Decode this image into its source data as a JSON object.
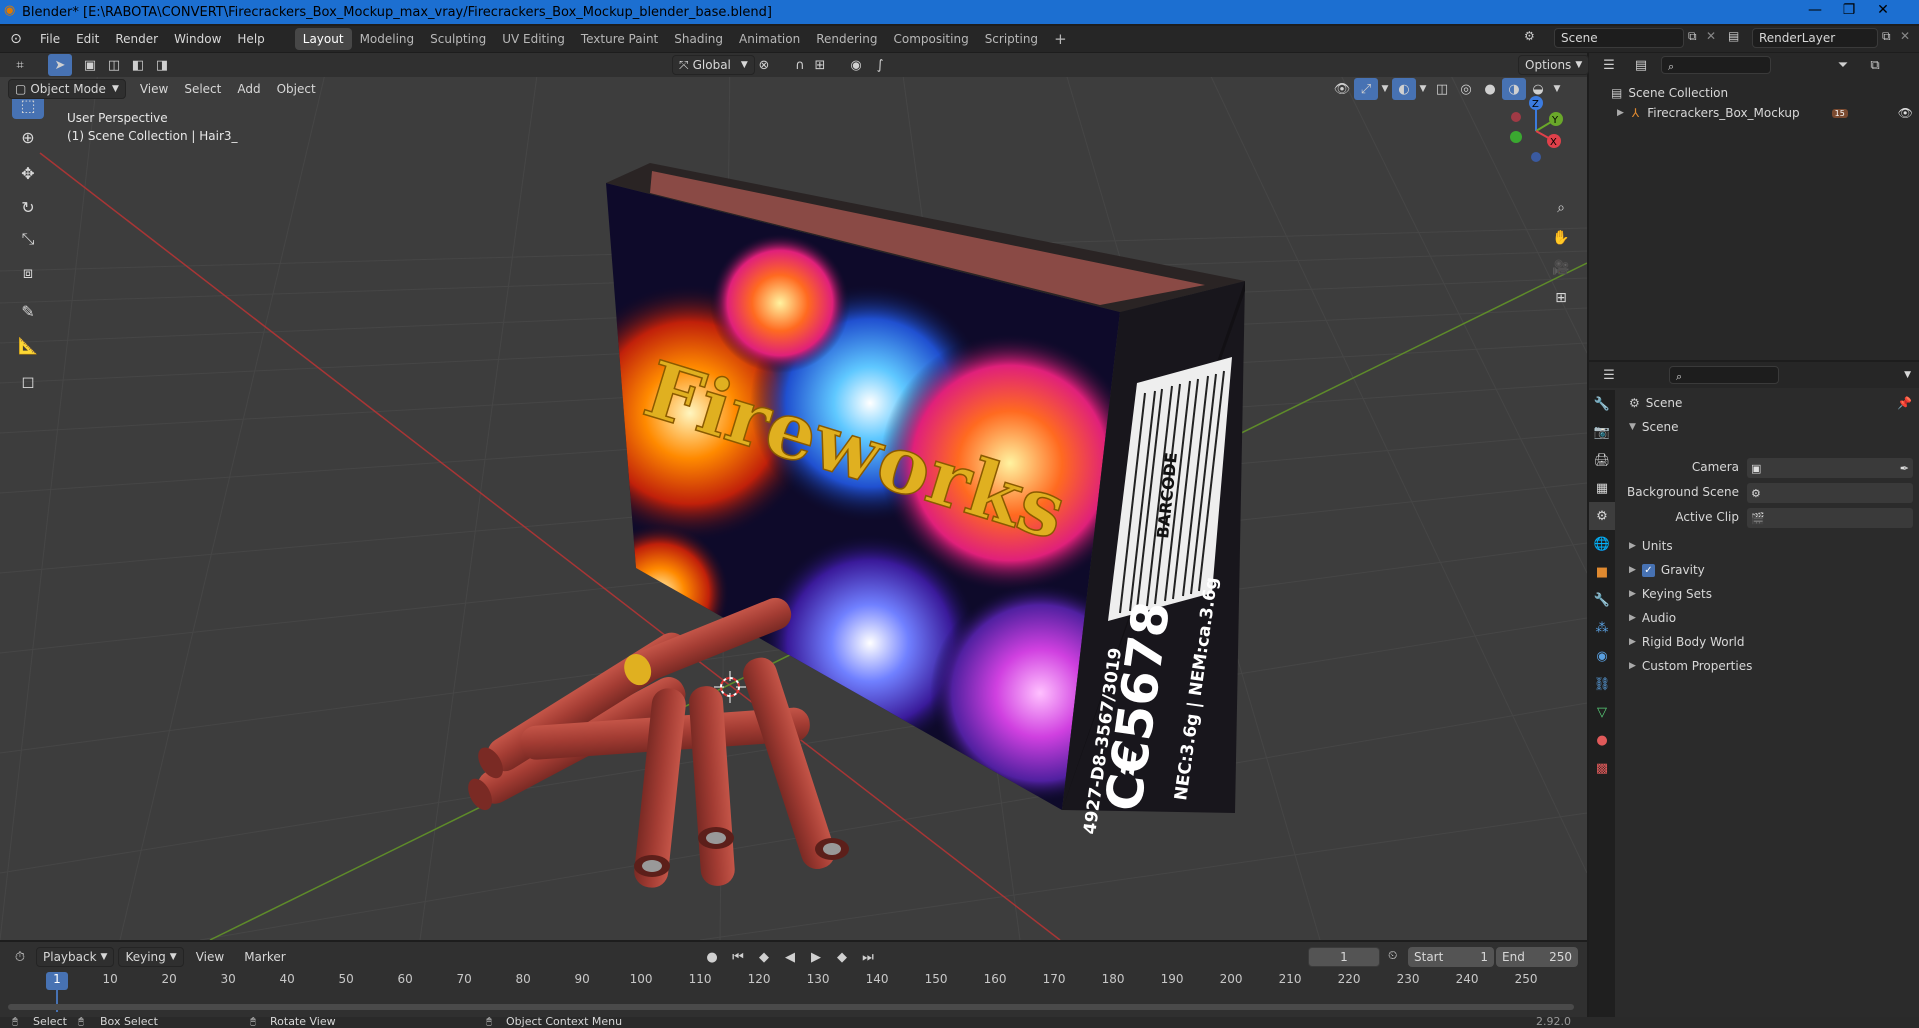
{
  "window": {
    "title": "Blender* [E:\\RABOTA\\CONVERT\\Firecrackers_Box_Mockup_max_vray/Firecrackers_Box_Mockup_blender_base.blend]",
    "controls": [
      "—",
      "❐",
      "✕"
    ]
  },
  "menu": [
    "File",
    "Edit",
    "Render",
    "Window",
    "Help"
  ],
  "workspaces": [
    "Layout",
    "Modeling",
    "Sculpting",
    "UV Editing",
    "Texture Paint",
    "Shading",
    "Animation",
    "Rendering",
    "Compositing",
    "Scripting"
  ],
  "active_workspace": "Layout",
  "scene_field": "Scene",
  "renderlayer_field": "RenderLayer",
  "viewport": {
    "mode": "Object Mode",
    "header_menus": [
      "View",
      "Select",
      "Add",
      "Object"
    ],
    "transform_orientation": "Global",
    "options_label": "Options",
    "overlay_line1": "User Perspective",
    "overlay_line2": "(1) Scene Collection | Hair3_",
    "gizmo_axes": [
      "X",
      "Y",
      "Z"
    ],
    "box_front_text": "Fireworks",
    "box_side_barcode": "BARCODE",
    "box_side_code": "C€5678",
    "box_side_line1": "4927-D8-3567/3019",
    "box_side_line2": "NEC:3.6g | NEM:ca.3.6g"
  },
  "outliner": {
    "root": "Scene Collection",
    "items": [
      {
        "label": "Firecrackers_Box_Mockup",
        "count": "15"
      }
    ]
  },
  "properties": {
    "context": "Scene",
    "panel": "Scene",
    "fields": [
      {
        "label": "Camera",
        "value": ""
      },
      {
        "label": "Background Scene",
        "value": ""
      },
      {
        "label": "Active Clip",
        "value": ""
      }
    ],
    "sections": [
      "Units",
      "Gravity",
      "Keying Sets",
      "Audio",
      "Rigid Body World",
      "Custom Properties"
    ],
    "gravity_checked": true
  },
  "timeline": {
    "menus": [
      "Playback",
      "Keying",
      "View",
      "Marker"
    ],
    "current_frame": "1",
    "start_label": "Start",
    "start": "1",
    "end_label": "End",
    "end": "250",
    "ticks": [
      "1",
      "10",
      "20",
      "30",
      "40",
      "50",
      "60",
      "70",
      "80",
      "90",
      "100",
      "110",
      "120",
      "130",
      "140",
      "150",
      "160",
      "170",
      "180",
      "190",
      "200",
      "210",
      "220",
      "230",
      "240",
      "250"
    ]
  },
  "statusbar": {
    "items": [
      "Select",
      "Box Select",
      "Rotate View",
      "Object Context Menu"
    ],
    "version": "2.92.0"
  },
  "colors": {
    "title_bar": "#1c6fd1",
    "viewport_bg": "#3d3d3d",
    "accent": "#4772b3",
    "box_lid": "#8a4a45",
    "firecracker": "#b5473c",
    "text_gold": "#e0b020"
  }
}
